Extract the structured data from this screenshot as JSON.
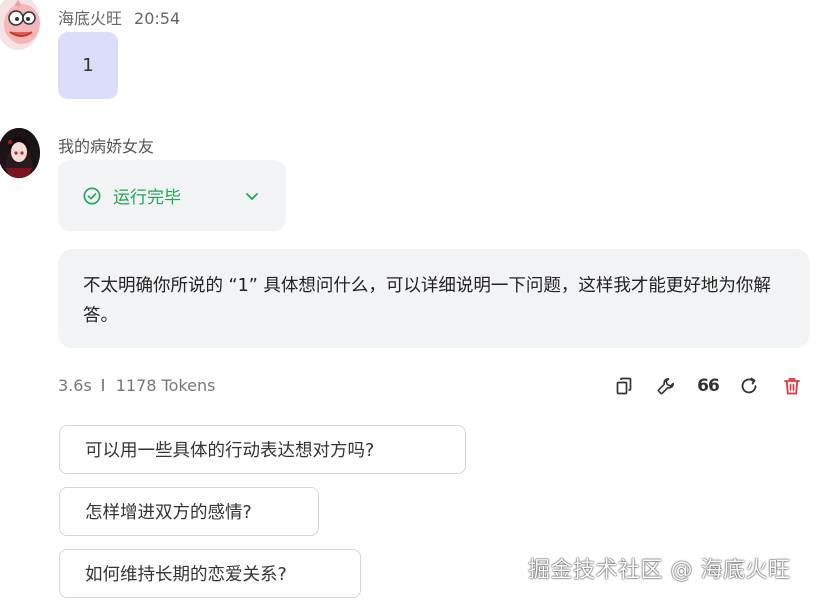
{
  "user_message": {
    "author": "海底火旺",
    "time": "20:54",
    "text": "1"
  },
  "bot_message": {
    "author": "我的病娇女友",
    "status": {
      "label": "运行完毕",
      "icon": "check-circle-icon",
      "color": "#1ea752"
    },
    "text": "不太明确你所说的 “1” 具体想问什么，可以详细说明一下问题，这样我才能更好地为你解答。",
    "stats": {
      "duration": "3.6s",
      "tokens": "1178 Tokens"
    },
    "actions": [
      {
        "name": "copy",
        "icon": "copy-icon"
      },
      {
        "name": "tools",
        "icon": "wrench-icon"
      },
      {
        "name": "quote",
        "icon": "quote-icon",
        "text": "66"
      },
      {
        "name": "regenerate",
        "icon": "refresh-icon"
      },
      {
        "name": "delete",
        "icon": "trash-icon",
        "color": "#e0373a"
      }
    ]
  },
  "suggestions": [
    "可以用一些具体的行动表达想对方吗?",
    "怎样增进双方的感情?",
    "如何维持长期的恋爱关系?"
  ],
  "watermark": "掘金技术社区 @ 海底火旺"
}
